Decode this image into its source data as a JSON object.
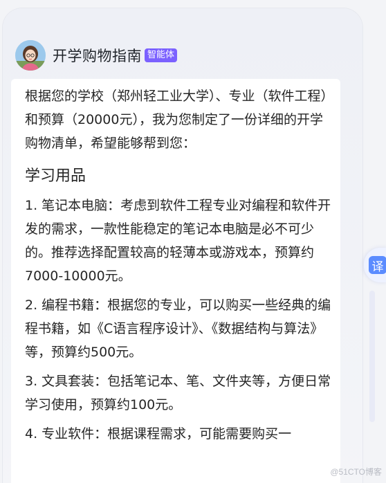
{
  "header": {
    "agent_name": "开学购物指南",
    "agent_badge": "智能体",
    "avatar_icon": "girl-avatar-icon"
  },
  "message": {
    "intro": "根据您的学校（郑州轻工业大学）、专业（软件工程）和预算（20000元），我为您制定了一份详细的开学购物清单，希望能够帮到您：",
    "section_title": "学习用品",
    "items": [
      "1. 笔记本电脑：考虑到软件工程专业对编程和软件开发的需求，一款性能稳定的笔记本电脑是必不可少的。推荐选择配置较高的轻薄本或游戏本，预算约7000-10000元。",
      "2. 编程书籍：根据您的专业，可以购买一些经典的编程书籍，如《C语言程序设计》、《数据结构与算法》等，预算约500元。",
      "3. 文具套装：包括笔记本、笔、文件夹等，方便日常学习使用，预算约100元。",
      "4. 专业软件：根据课程需求，可能需要购买一"
    ]
  },
  "side": {
    "translate_label": "译"
  },
  "watermark": "@51CTO博客",
  "colors": {
    "badge": "#7b61ff",
    "translate": "#5b8cff"
  }
}
